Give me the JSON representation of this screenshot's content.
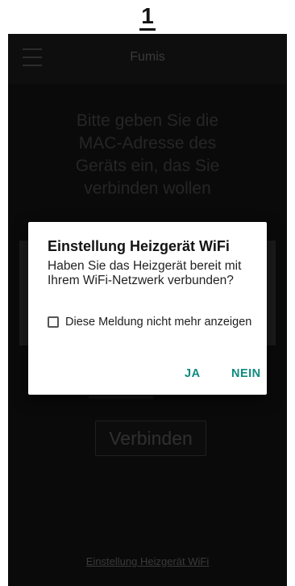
{
  "step_number": "1",
  "app": {
    "title": "Fumis",
    "instruction": "Bitte geben Sie die MAC-Adresse des Geräts ein, das Sie verbinden wollen",
    "connect_button": "Verbinden",
    "footer_link": "Einstellung Heizgerät WiFi"
  },
  "dialog": {
    "title": "Einstellung Heizgerät WiFi",
    "message": "Haben Sie das Heizgerät bereit mit Ihrem WiFi-Netzwerk verbunden?",
    "checkbox_label": "Diese Meldung nicht mehr anzeigen",
    "checkbox_checked": false,
    "confirm_button": "JA",
    "cancel_button": "NEIN"
  },
  "colors": {
    "accent": "#0f8a80",
    "background": "#0a0a0a",
    "dialog_background": "#ffffff"
  },
  "icons": {
    "menu": "hamburger-menu-icon"
  }
}
